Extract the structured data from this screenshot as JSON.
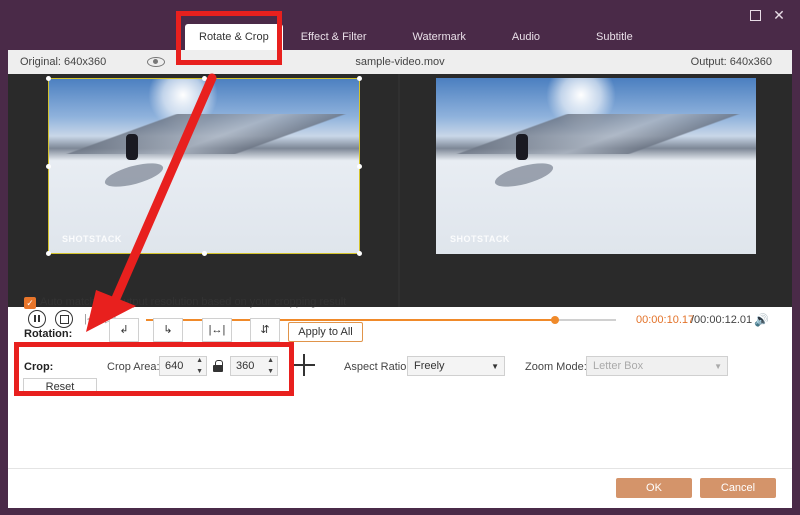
{
  "window": {
    "maximize_icon": "maximize-icon",
    "close_glyph": "✕"
  },
  "tabs": [
    {
      "label": "Rotate & Crop",
      "active": true
    },
    {
      "label": "Effect & Filter",
      "active": false
    },
    {
      "label": "Watermark",
      "active": false
    },
    {
      "label": "Audio",
      "active": false
    },
    {
      "label": "Subtitle",
      "active": false
    }
  ],
  "preview": {
    "original_label": "Original: 640x360",
    "file_name": "sample-video.mov",
    "output_label": "Output: 640x360",
    "watermark_left": "SHOTSTACK",
    "watermark_right": "SHOTSTACK"
  },
  "playback": {
    "time_current": "00:00:10.17",
    "time_total": "/00:00:12.01",
    "progress": 0.87,
    "prev_glyph": "|◁",
    "next_glyph": "▷|",
    "volume_glyph": "🔊"
  },
  "settings": {
    "automatch_checked": true,
    "automatch_label": "Auto match the output resolution based on your cropping result",
    "rotation_label": "Rotation:",
    "rotate_left_glyph": "↲",
    "rotate_right_glyph": "↳",
    "flip_horizontal_glyph": "|↔|",
    "flip_vertical_glyph": "⇵",
    "apply_to_all_label": "Apply to All",
    "crop_label": "Crop:",
    "crop_area_label": "Crop Area:",
    "crop_width": "640",
    "crop_height": "360",
    "aspect_ratio_label": "Aspect Ratio:",
    "aspect_ratio_value": "Freely",
    "zoom_mode_label": "Zoom Mode:",
    "zoom_mode_value": "Letter Box",
    "reset_label": "Reset"
  },
  "footer": {
    "ok_label": "OK",
    "cancel_label": "Cancel"
  },
  "colors": {
    "accent": "#e8752a",
    "button": "#d4946a",
    "annotation": "#e8201e",
    "titlebar": "#4a2a48"
  }
}
